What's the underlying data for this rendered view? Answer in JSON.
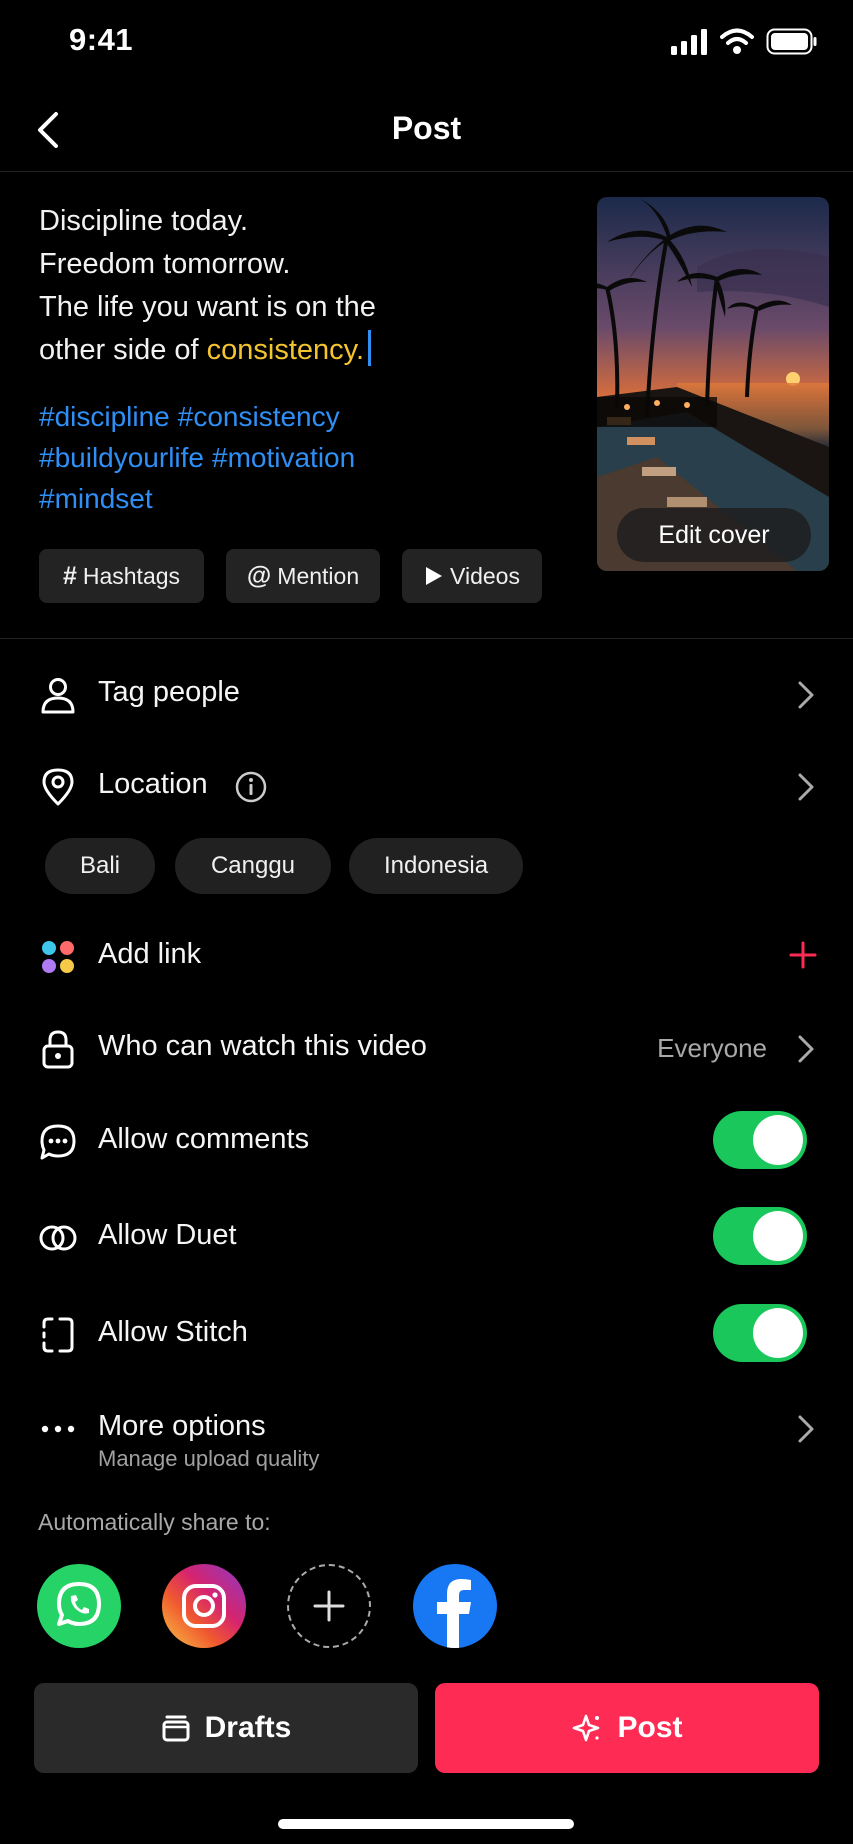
{
  "status_bar": {
    "time": "9:41"
  },
  "header": {
    "title": "Post"
  },
  "caption": {
    "line1": "Discipline today.",
    "line2": "Freedom tomorrow.",
    "line3": "The life you want is on the",
    "line4_prefix": "other side of ",
    "line4_highlight": "consistency."
  },
  "hashtags": [
    "#discipline",
    "#consistency",
    "#buildyourlife",
    "#motivation",
    "#mindset"
  ],
  "chips": [
    {
      "icon": "#",
      "label": "Hashtags"
    },
    {
      "icon": "@",
      "label": "Mention"
    },
    {
      "icon": "play",
      "label": "Videos"
    }
  ],
  "cover": {
    "edit_label": "Edit cover"
  },
  "rows": {
    "tag_people": "Tag people",
    "location": "Location",
    "add_link": "Add link",
    "who_can_watch": "Who can watch this video",
    "who_can_watch_value": "Everyone",
    "allow_comments": "Allow comments",
    "allow_duet": "Allow Duet",
    "allow_stitch": "Allow Stitch",
    "more_options": "More options",
    "more_options_sub": "Manage upload quality"
  },
  "toggles": {
    "allow_comments": true,
    "allow_duet": true,
    "allow_stitch": true
  },
  "location_chips": [
    "Bali",
    "Canggu",
    "Indonesia"
  ],
  "share": {
    "label": "Automatically share to:",
    "targets": [
      "whatsapp-icon",
      "instagram-icon",
      "add-icon",
      "facebook-icon"
    ]
  },
  "buttons": {
    "drafts": "Drafts",
    "post": "Post"
  },
  "colors": {
    "accent": "#fe2c55",
    "toggle_on": "#19c75b",
    "hashtag": "#2f8ff5",
    "highlight": "#f4c42f"
  }
}
